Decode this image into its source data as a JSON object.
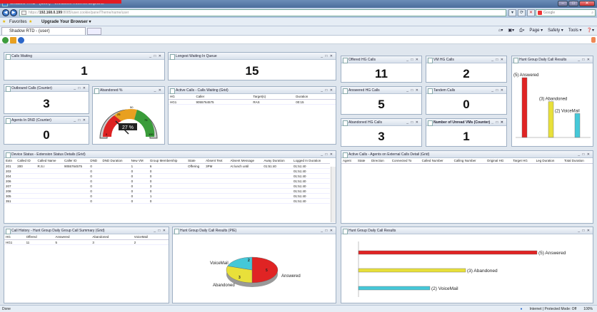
{
  "browser": {
    "title": "Shadow RTD - (user) - Windows Internet Explorer",
    "url_scheme": "https://",
    "url_host": "192.168.0.199",
    "url_rest": ":8085/user.cookie/panelTheme/name/user",
    "search_placeholder": "Google",
    "favorites": "Favorites",
    "upgrade": "Upgrade Your Browser ▾",
    "tab": "Shadow RTD - (user)",
    "cmd": {
      "page": "Page ▾",
      "safety": "Safety ▾",
      "tools": "Tools ▾",
      "help": "❓▾"
    },
    "status_left": "Done",
    "status_zone": "Internet | Protected Mode: Off",
    "zoom": "100%",
    "icons": [
      "back-icon",
      "forward-icon",
      "favorites-star-icon",
      "add-favorites-icon",
      "home-icon",
      "feeds-icon",
      "print-icon",
      "refresh-icon",
      "stop-icon",
      "search-icon",
      "help-icon"
    ]
  },
  "widgets": {
    "calls_waiting": {
      "title": "Calls Waiting",
      "value": "1"
    },
    "longest_wait": {
      "title": "Longest Waiting In Queue",
      "value": "15"
    },
    "offered_hg": {
      "title": "Offered HG Calls",
      "value": "11"
    },
    "vm_hg": {
      "title": "VM HG Calls",
      "value": "2"
    },
    "outbound": {
      "title": "Outbound Calls (Counter)",
      "value": "3"
    },
    "abandoned_pct": {
      "title": "Abandoned %",
      "value": "27 %",
      "ticks": [
        "0",
        "25",
        "50",
        "75",
        "100"
      ]
    },
    "answered_hg": {
      "title": "Answered HG Calls",
      "value": "5"
    },
    "tandem": {
      "title": "Tandem Calls",
      "value": "0"
    },
    "agents_dnd": {
      "title": "Agents In DND (Counter)",
      "value": "0"
    },
    "abandoned_hg": {
      "title": "Abandoned HG Calls",
      "value": "3"
    },
    "unread_vm": {
      "title": "Number of Unread VMs (Counter)",
      "value": "1"
    }
  },
  "active_waiting": {
    "title": "Active Calls - Calls Waiting (Grid)",
    "headers": [
      "HG",
      "Caller",
      "Target(s)",
      "Duration"
    ],
    "rows": [
      [
        "HG1",
        "9055764575",
        "RAS",
        "00:15"
      ]
    ]
  },
  "device_status": {
    "title": "Device Status - Extension Status Details (Grid)",
    "headers": [
      "Extn",
      "Called ID",
      "Called Name",
      "Caller ID",
      "DND",
      "DND Duration",
      "New VM",
      "Group Membership",
      "State",
      "Absent Text",
      "Absent Message",
      "Away Duration",
      "Logged In Duration"
    ],
    "rows": [
      [
        "201",
        "200",
        "R.S.I",
        "9055764575",
        "0",
        "",
        "1",
        "6",
        "Offering",
        "3PM",
        "At lunch until",
        "01:51:40",
        "01:51:40"
      ],
      [
        "203",
        "",
        "",
        "",
        "0",
        "",
        "0",
        "0",
        "",
        "",
        "",
        "",
        "01:51:40"
      ],
      [
        "204",
        "",
        "",
        "",
        "0",
        "",
        "0",
        "0",
        "",
        "",
        "",
        "",
        "01:51:40"
      ],
      [
        "206",
        "",
        "",
        "",
        "0",
        "",
        "0",
        "0",
        "",
        "",
        "",
        "",
        "01:51:40"
      ],
      [
        "207",
        "",
        "",
        "",
        "0",
        "",
        "0",
        "3",
        "",
        "",
        "",
        "",
        "01:51:40"
      ],
      [
        "208",
        "",
        "",
        "",
        "0",
        "",
        "0",
        "0",
        "",
        "",
        "",
        "",
        "01:51:40"
      ],
      [
        "305",
        "",
        "",
        "",
        "0",
        "",
        "0",
        "1",
        "",
        "",
        "",
        "",
        "01:51:40"
      ],
      [
        "351",
        "",
        "",
        "",
        "0",
        "",
        "0",
        "0",
        "",
        "",
        "",
        "",
        "01:51:40"
      ]
    ]
  },
  "external_calls": {
    "title": "Active Calls - Agents on External Calls Detail (Grid)",
    "headers": [
      "Agent",
      "State",
      "Direction",
      "Connected To",
      "Called Number",
      "Calling Number",
      "Original HG",
      "Target HG",
      "Leg Duration",
      "Total Duration"
    ]
  },
  "call_history": {
    "title": "Call History - Hunt Group Daily Group Call Summary (Grid)",
    "headers": [
      "HG",
      "Offered",
      "Answered",
      "Abandoned",
      "VoiceMail"
    ],
    "rows": [
      [
        "HG1",
        "11",
        "5",
        "3",
        "2"
      ]
    ]
  },
  "colors": {
    "answered": "#e02424",
    "abandoned": "#e8e03a",
    "voicemail": "#45c8d8"
  },
  "chart_data": [
    {
      "type": "bar",
      "title": "Hunt Group Daily Call Results",
      "categories": [
        "Answered",
        "Abandoned",
        "VoiceMail"
      ],
      "values": [
        5,
        3,
        2
      ],
      "labels": [
        "(5) Answered",
        "(3) Abandoned",
        "(2) VoiceMail"
      ]
    },
    {
      "type": "pie",
      "title": "Hunt Group Daily Call Results (PIE)",
      "categories": [
        "Answered",
        "Abandoned",
        "VoiceMail"
      ],
      "values": [
        5,
        3,
        2
      ],
      "value_labels": [
        "5",
        "3",
        "2"
      ]
    },
    {
      "type": "bar",
      "orientation": "horizontal",
      "title": "Hunt Group Daily Call Results",
      "categories": [
        "Answered",
        "Abandoned",
        "VoiceMail"
      ],
      "values": [
        5,
        3,
        2
      ],
      "labels": [
        "(5) Answered",
        "(3) Abandoned",
        "(2) VoiceMail"
      ]
    }
  ]
}
